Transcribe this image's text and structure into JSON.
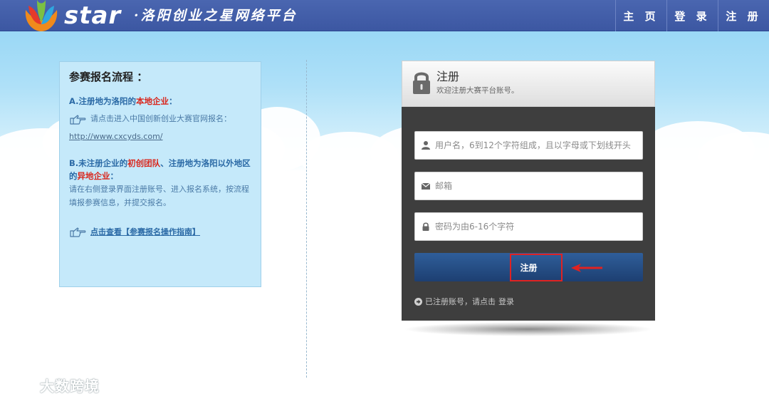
{
  "header": {
    "logo_star": "star",
    "logo_sub": "·洛阳创业之星网络平台",
    "nav": [
      {
        "label": "主 页"
      },
      {
        "label": "登 录"
      },
      {
        "label": "注 册"
      }
    ]
  },
  "info": {
    "title": "参赛报名流程 ：",
    "section_a": {
      "head_prefix": "A.注册地为洛阳的",
      "head_red": "本地企业",
      "head_suffix": "：",
      "hint": "请点击进入中国创新创业大赛官网报名：",
      "link": "http://www.cxcyds.com/"
    },
    "section_b": {
      "head_prefix": "B.未注册企业的",
      "head_red1": "初创团队",
      "head_mid": "、注册地为洛阳以外地区的",
      "head_red2": "异地企业",
      "head_suffix": "：",
      "text": "请在右侧登录界面注册账号、进入报名系统，按流程填报参赛信息，并提交报名。"
    },
    "guide": "点击查看【参赛报名操作指南】"
  },
  "register": {
    "title": "注册",
    "subtitle": "欢迎注册大赛平台账号。",
    "username_placeholder": "用户名，6到12个字符组成，且以字母或下划线开头",
    "email_placeholder": "邮箱",
    "password_placeholder": "密码为由6-16个字符",
    "submit_label": "注册",
    "login_prefix": "已注册账号，请点击",
    "login_link": "登录"
  },
  "watermark": "大数跨境",
  "colors": {
    "header": "#3c57a2",
    "panel": "#c5e9fa",
    "form_body": "#3e3e3e",
    "button": "#1d3f72",
    "highlight": "#e02222",
    "accent_red": "#d9261c"
  }
}
